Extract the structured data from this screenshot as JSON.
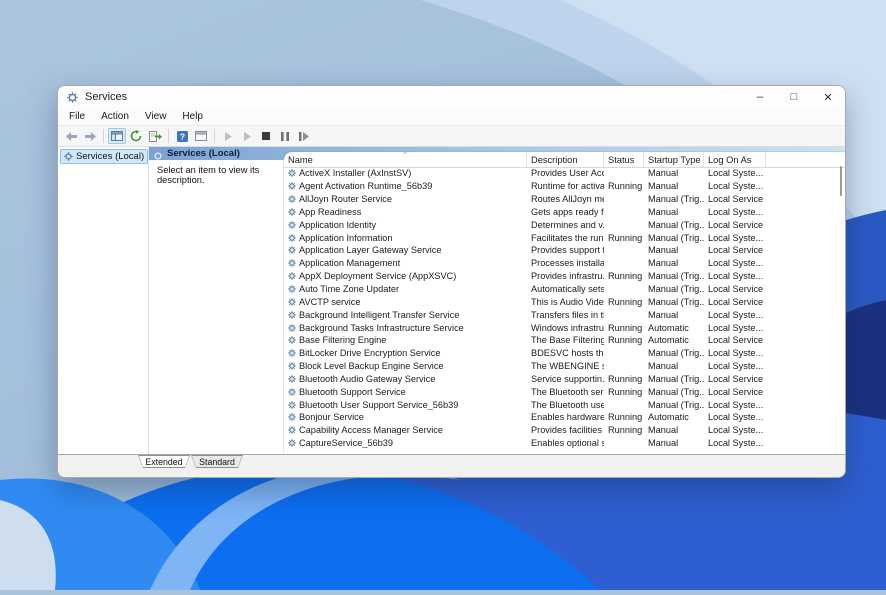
{
  "window": {
    "title": "Services",
    "controls": {
      "minimize": "–",
      "maximize": "□",
      "close": "✕"
    }
  },
  "menu": {
    "items": [
      "File",
      "Action",
      "View",
      "Help"
    ]
  },
  "toolbar": {
    "icons": [
      "back-icon",
      "forward-icon",
      "show-console-tree-icon",
      "refresh-icon",
      "export-list-icon",
      "help-icon",
      "properties-window-icon",
      "start-service-icon",
      "resume-service-icon",
      "stop-service-icon",
      "pause-service-icon",
      "restart-service-icon"
    ]
  },
  "sidebar": {
    "root_label": "Services (Local)"
  },
  "pane": {
    "header_label": "Services (Local)",
    "description_placeholder": "Select an item to view its description.",
    "sort_indicator": "^"
  },
  "tabs": {
    "extended": "Extended",
    "standard": "Standard"
  },
  "colors": {
    "accent_selection": "#cfe8fb",
    "band_gradient_start": "#7aa2d3",
    "band_gradient_end": "#cfe1f2",
    "wallpaper_top": "#a9c3dd",
    "wallpaper_bright_blue": "#0d6ef0",
    "wallpaper_navy": "#1b3180"
  },
  "table": {
    "columns": [
      "Name",
      "Description",
      "Status",
      "Startup Type",
      "Log On As"
    ],
    "rows": [
      {
        "name": "ActiveX Installer (AxInstSV)",
        "description": "Provides User Acc...",
        "status": "",
        "startup_type": "Manual",
        "log_on_as": "Local Syste..."
      },
      {
        "name": "Agent Activation Runtime_56b39",
        "description": "Runtime for activa...",
        "status": "Running",
        "startup_type": "Manual",
        "log_on_as": "Local Syste..."
      },
      {
        "name": "AllJoyn Router Service",
        "description": "Routes AllJoyn me...",
        "status": "",
        "startup_type": "Manual (Trig...",
        "log_on_as": "Local Service"
      },
      {
        "name": "App Readiness",
        "description": "Gets apps ready fo...",
        "status": "",
        "startup_type": "Manual",
        "log_on_as": "Local Syste..."
      },
      {
        "name": "Application Identity",
        "description": "Determines and v...",
        "status": "",
        "startup_type": "Manual (Trig...",
        "log_on_as": "Local Service"
      },
      {
        "name": "Application Information",
        "description": "Facilitates the run...",
        "status": "Running",
        "startup_type": "Manual (Trig...",
        "log_on_as": "Local Syste..."
      },
      {
        "name": "Application Layer Gateway Service",
        "description": "Provides support f...",
        "status": "",
        "startup_type": "Manual",
        "log_on_as": "Local Service"
      },
      {
        "name": "Application Management",
        "description": "Processes installat...",
        "status": "",
        "startup_type": "Manual",
        "log_on_as": "Local Syste..."
      },
      {
        "name": "AppX Deployment Service (AppXSVC)",
        "description": "Provides infrastru...",
        "status": "Running",
        "startup_type": "Manual (Trig...",
        "log_on_as": "Local Syste..."
      },
      {
        "name": "Auto Time Zone Updater",
        "description": "Automatically sets...",
        "status": "",
        "startup_type": "Manual (Trig...",
        "log_on_as": "Local Service"
      },
      {
        "name": "AVCTP service",
        "description": "This is Audio Vide...",
        "status": "Running",
        "startup_type": "Manual (Trig...",
        "log_on_as": "Local Service"
      },
      {
        "name": "Background Intelligent Transfer Service",
        "description": "Transfers files in th...",
        "status": "",
        "startup_type": "Manual",
        "log_on_as": "Local Syste..."
      },
      {
        "name": "Background Tasks Infrastructure Service",
        "description": "Windows infrastru...",
        "status": "Running",
        "startup_type": "Automatic",
        "log_on_as": "Local Syste..."
      },
      {
        "name": "Base Filtering Engine",
        "description": "The Base Filtering ...",
        "status": "Running",
        "startup_type": "Automatic",
        "log_on_as": "Local Service"
      },
      {
        "name": "BitLocker Drive Encryption Service",
        "description": "BDESVC hosts the ...",
        "status": "",
        "startup_type": "Manual (Trig...",
        "log_on_as": "Local Syste..."
      },
      {
        "name": "Block Level Backup Engine Service",
        "description": "The WBENGINE se...",
        "status": "",
        "startup_type": "Manual",
        "log_on_as": "Local Syste..."
      },
      {
        "name": "Bluetooth Audio Gateway Service",
        "description": "Service supportin...",
        "status": "Running",
        "startup_type": "Manual (Trig...",
        "log_on_as": "Local Service"
      },
      {
        "name": "Bluetooth Support Service",
        "description": "The Bluetooth ser...",
        "status": "Running",
        "startup_type": "Manual (Trig...",
        "log_on_as": "Local Service"
      },
      {
        "name": "Bluetooth User Support Service_56b39",
        "description": "The Bluetooth use...",
        "status": "",
        "startup_type": "Manual (Trig...",
        "log_on_as": "Local Syste..."
      },
      {
        "name": "Bonjour Service",
        "description": "Enables hardware ...",
        "status": "Running",
        "startup_type": "Automatic",
        "log_on_as": "Local Syste..."
      },
      {
        "name": "Capability Access Manager Service",
        "description": "Provides facilities ...",
        "status": "Running",
        "startup_type": "Manual",
        "log_on_as": "Local Syste..."
      },
      {
        "name": "CaptureService_56b39",
        "description": "Enables optional s...",
        "status": "",
        "startup_type": "Manual",
        "log_on_as": "Local Syste..."
      }
    ]
  }
}
